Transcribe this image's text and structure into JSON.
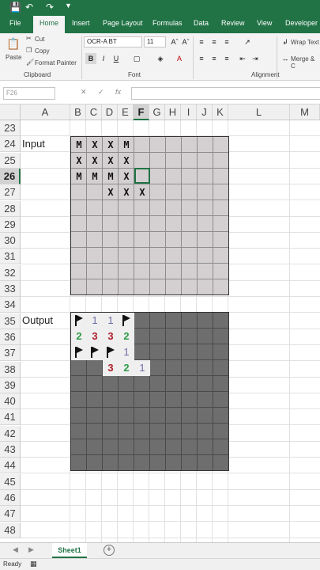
{
  "qat": {
    "save_icon": "save-icon",
    "undo_icon": "undo-icon",
    "redo_icon": "redo-icon"
  },
  "tabs": [
    "File",
    "Home",
    "Insert",
    "Page Layout",
    "Formulas",
    "Data",
    "Review",
    "View",
    "Developer"
  ],
  "active_tab": "Home",
  "clipboard": {
    "paste": "Paste",
    "cut": "Cut",
    "copy": "Copy",
    "format_painter": "Format Painter",
    "group": "Clipboard"
  },
  "font": {
    "name": "OCR-A BT",
    "size": "11",
    "bold": "B",
    "italic": "I",
    "underline": "U",
    "group": "Font"
  },
  "alignment": {
    "wrap": "Wrap Text",
    "merge": "Merge & C",
    "group": "Alignment"
  },
  "namebox": "F26",
  "formula_icons": "fx",
  "columns": [
    "A",
    "B",
    "C",
    "D",
    "E",
    "F",
    "G",
    "H",
    "I",
    "J",
    "K",
    "L",
    "M"
  ],
  "selected_column": "F",
  "rows": [
    "23",
    "24",
    "25",
    "26",
    "27",
    "28",
    "29",
    "30",
    "31",
    "32",
    "33",
    "34",
    "35",
    "36",
    "37",
    "38",
    "39",
    "40",
    "41",
    "42",
    "43",
    "44",
    "45",
    "46",
    "47",
    "48"
  ],
  "selected_row": "26",
  "labels": {
    "input": "Input",
    "output": "Output"
  },
  "input_cells": [
    [
      "M",
      "X",
      "X",
      "M",
      "",
      "",
      "",
      "",
      "",
      ""
    ],
    [
      "X",
      "X",
      "X",
      "X",
      "",
      "",
      "",
      "",
      "",
      ""
    ],
    [
      "M",
      "M",
      "M",
      "X",
      "",
      "",
      "",
      "",
      "",
      ""
    ],
    [
      "",
      "",
      "X",
      "X",
      "X",
      "",
      "",
      "",
      "",
      ""
    ]
  ],
  "output_cells": [
    [
      "F",
      "1",
      "1",
      "F"
    ],
    [
      "2",
      "3",
      "3",
      "2"
    ],
    [
      "F",
      "F",
      "F",
      "1"
    ],
    [
      "",
      "",
      "3",
      "2",
      "1"
    ]
  ],
  "sheet": "Sheet1",
  "status": "Ready"
}
